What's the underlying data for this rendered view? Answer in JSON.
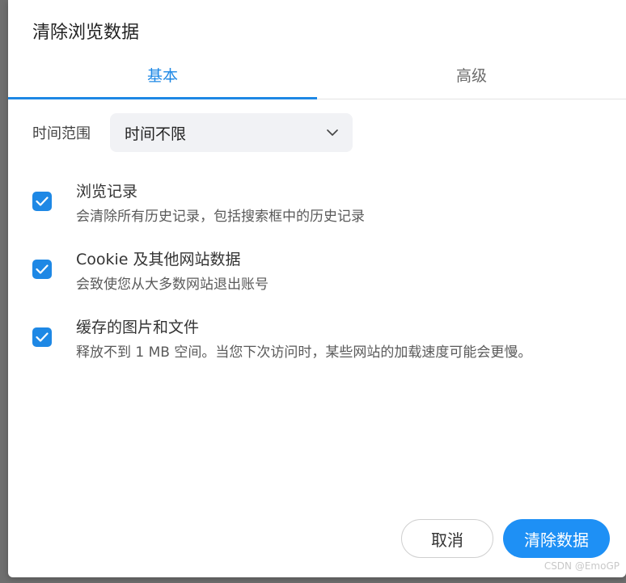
{
  "dialog": {
    "title": "清除浏览数据",
    "tabs": [
      {
        "label": "基本",
        "active": true
      },
      {
        "label": "高级",
        "active": false
      }
    ],
    "time_range": {
      "label": "时间范围",
      "selected": "时间不限"
    },
    "options": [
      {
        "title": "浏览记录",
        "description": "会清除所有历史记录，包括搜索框中的历史记录",
        "checked": true
      },
      {
        "title": "Cookie 及其他网站数据",
        "description": "会致使您从大多数网站退出账号",
        "checked": true
      },
      {
        "title": "缓存的图片和文件",
        "description": "释放不到 1 MB 空间。当您下次访问时，某些网站的加载速度可能会更慢。",
        "checked": true
      }
    ],
    "buttons": {
      "cancel": "取消",
      "clear": "清除数据"
    }
  },
  "watermark": "CSDN @EmoGP",
  "colors": {
    "accent": "#1e88e5",
    "primary_button": "#1e90f5"
  }
}
